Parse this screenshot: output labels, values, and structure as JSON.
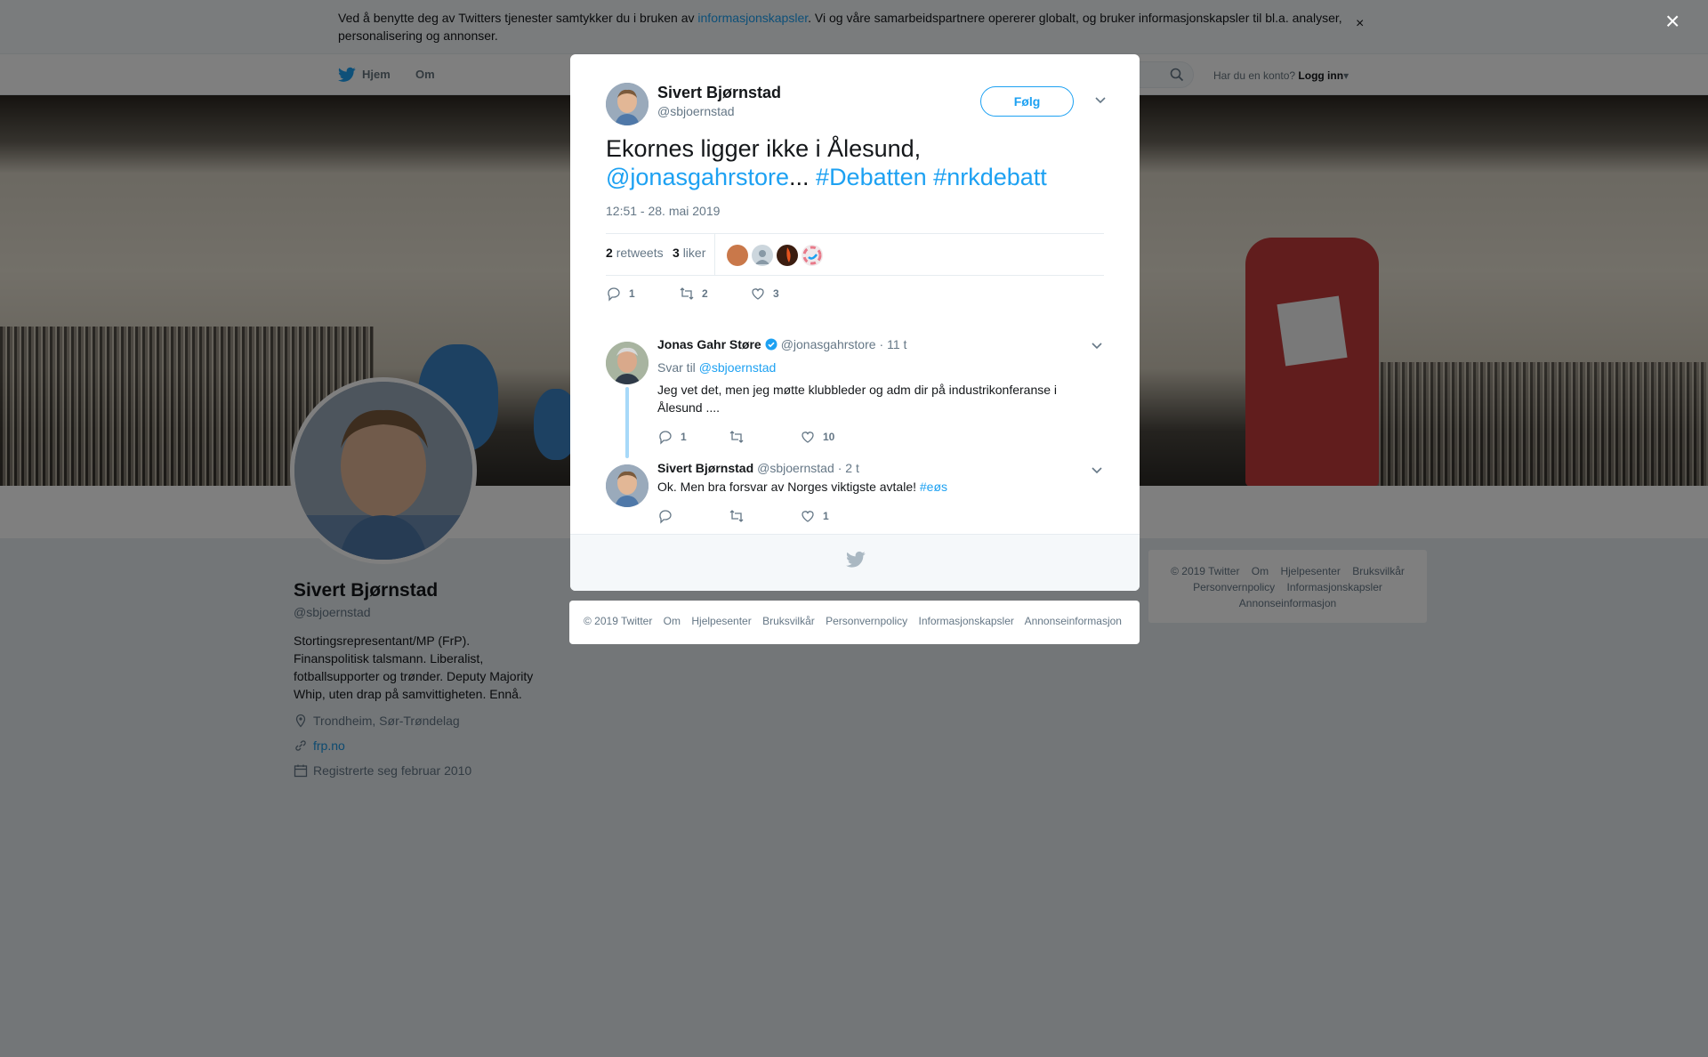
{
  "cookie": {
    "text_before": "Ved å benytte deg av Twitters tjenester samtykker du i bruken av ",
    "link": "informasjonskapsler",
    "text_after": ". Vi og våre samarbeidspartnere opererer globalt, og bruker informasjonskapsler til bl.a. analyser, personalisering og annonser.",
    "close": "×"
  },
  "nav": {
    "home": "Hjem",
    "about": "Om",
    "have_account": "Har du en konto?",
    "login": "Logg inn"
  },
  "profile": {
    "name": "Sivert Bjørnstad",
    "handle": "@sbjoernstad",
    "bio": "Stortingsrepresentant/MP (FrP). Finanspolitisk talsmann. Liberalist, fotballsupporter og trønder. Deputy Majority Whip, uten drap på samvittigheten. Ennå.",
    "location": "Trondheim, Sør-Trøndelag",
    "website": "frp.no",
    "joined": "Registrerte seg februar 2010"
  },
  "side_footer": {
    "links": [
      "© 2019 Twitter",
      "Om",
      "Hjelpesenter",
      "Bruksvilkår",
      "Personvernpolicy",
      "Informasjonskapsler",
      "Annonseinformasjon"
    ]
  },
  "modal": {
    "close": "×",
    "author_name": "Sivert Bjørnstad",
    "author_handle": "@sbjoernstad",
    "follow": "Følg",
    "tweet_plain": "Ekornes ligger ikke i Ålesund, ",
    "tweet_mention": "@jonasgahrstore",
    "tweet_ellipsis": "... ",
    "tweet_tag1": "#Debatten",
    "tweet_tag2": "#nrkdebatt",
    "time": "12:51 - 28. mai 2019",
    "retweets_count": "2",
    "retweets_label": "retweets",
    "likes_count": "3",
    "likes_label": "liker",
    "actions": {
      "reply": "1",
      "retweet": "2",
      "like": "3"
    }
  },
  "replies": [
    {
      "name": "Jonas Gahr Støre",
      "handle": "@jonasgahrstore",
      "age": "· 11 t",
      "reply_to_label": "Svar til ",
      "reply_to": "@sbjoernstad",
      "text": "Jeg vet det, men jeg møtte klubbleder og adm dir på industrikonferanse i Ålesund ....",
      "actions": {
        "reply": "1",
        "retweet": "",
        "like": "10"
      }
    },
    {
      "name": "Sivert Bjørnstad",
      "handle": "@sbjoernstad",
      "age": "· 2 t",
      "text": "Ok. Men bra forsvar av Norges viktigste avtale! ",
      "tag": "#eøs",
      "actions": {
        "reply": "",
        "retweet": "",
        "like": "1"
      }
    }
  ],
  "modal_footer_links": [
    "© 2019 Twitter",
    "Om",
    "Hjelpesenter",
    "Bruksvilkår",
    "Personvernpolicy",
    "Informasjonskapsler",
    "Annonseinformasjon"
  ],
  "colors": {
    "accent": "#1da1f2",
    "text": "#14171a",
    "muted": "#657786"
  },
  "icons": [
    "twitter-bird-icon",
    "search-icon",
    "location-icon",
    "link-icon",
    "calendar-icon",
    "reply-icon",
    "retweet-icon",
    "like-icon",
    "verified-icon",
    "chevron-down-icon",
    "close-icon"
  ]
}
